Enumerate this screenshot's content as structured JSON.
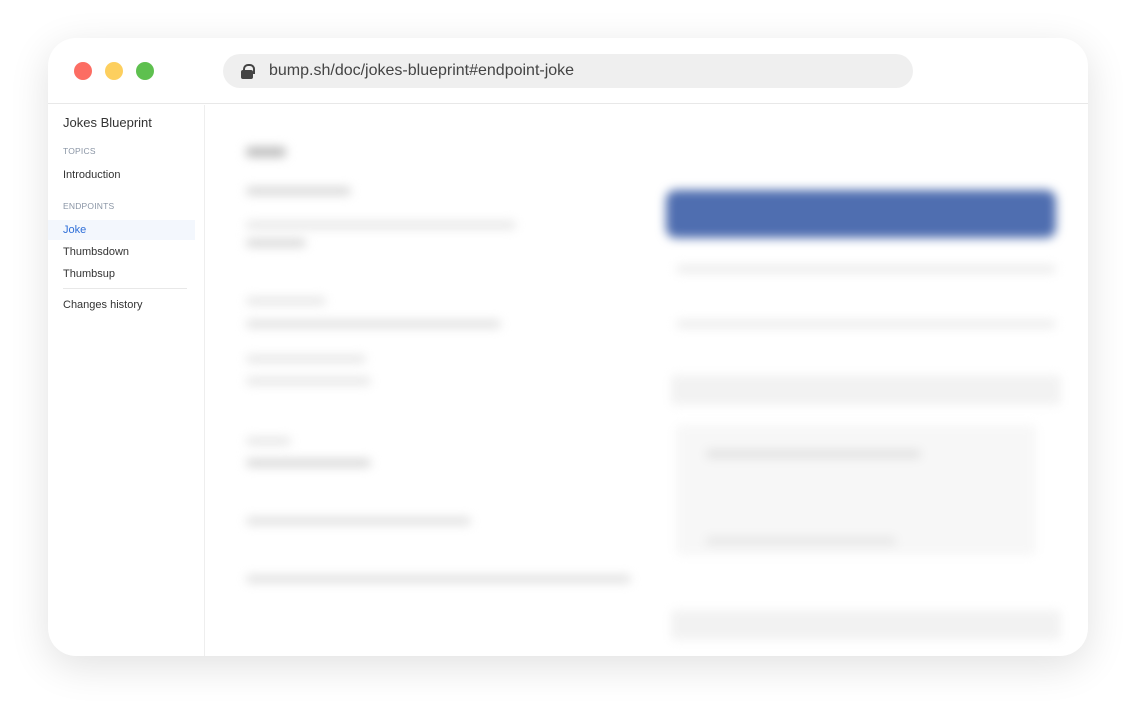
{
  "window": {
    "traffic_lights": {
      "close": "#fc6d63",
      "minimize": "#fdcf5e",
      "maximize": "#5ec04f"
    },
    "url": "bump.sh/doc/jokes-blueprint#endpoint-joke"
  },
  "sidebar": {
    "title": "Jokes Blueprint",
    "sections": [
      {
        "label": "TOPICS",
        "items": [
          {
            "label": "Introduction"
          }
        ]
      },
      {
        "label": "ENDPOINTS",
        "items": [
          {
            "label": "Joke",
            "active": true
          },
          {
            "label": "Thumbsdown"
          },
          {
            "label": "Thumbsup"
          }
        ]
      }
    ],
    "footer_item": "Changes history"
  },
  "colors": {
    "accent": "#2f6fd8",
    "header_bar": "#4f6eb0"
  }
}
